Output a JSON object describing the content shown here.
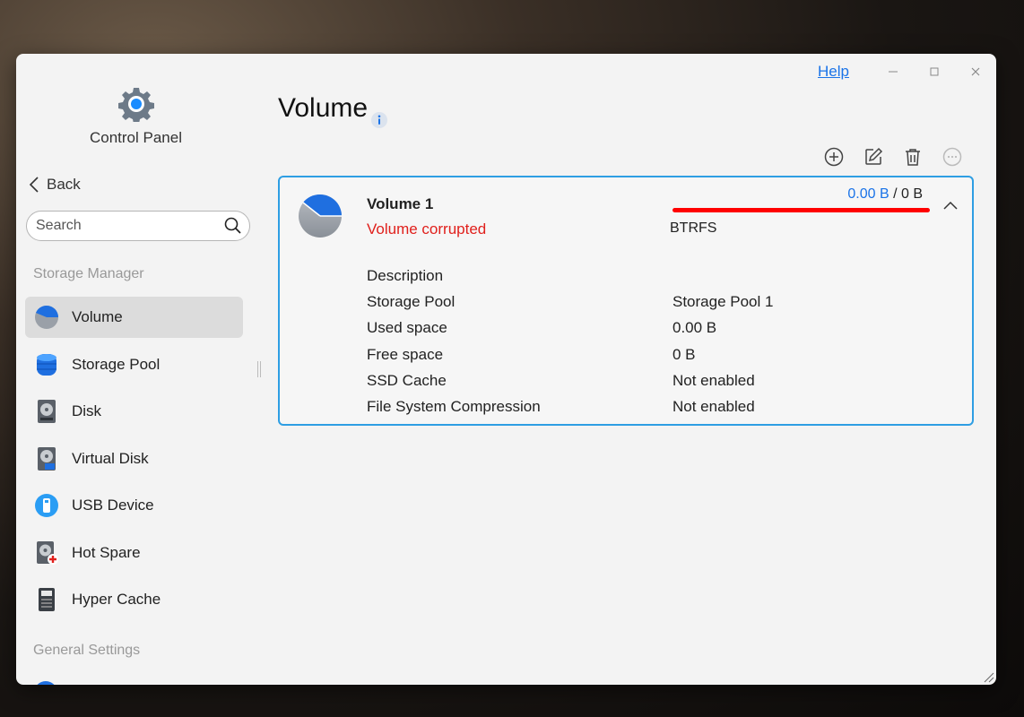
{
  "window": {
    "help_label": "Help"
  },
  "sidebar": {
    "app_name": "Control Panel",
    "back_label": "Back",
    "search_placeholder": "Search",
    "section_storage": "Storage Manager",
    "section_general": "General Settings",
    "items": [
      {
        "label": "Volume",
        "icon": "volume-pie-icon",
        "active": true
      },
      {
        "label": "Storage Pool",
        "icon": "storage-pool-icon"
      },
      {
        "label": "Disk",
        "icon": "disk-icon"
      },
      {
        "label": "Virtual Disk",
        "icon": "virtual-disk-icon"
      },
      {
        "label": "USB Device",
        "icon": "usb-icon"
      },
      {
        "label": "Hot Spare",
        "icon": "hot-spare-icon"
      },
      {
        "label": "Hyper Cache",
        "icon": "ssd-cache-icon"
      }
    ]
  },
  "main": {
    "title": "Volume",
    "volume": {
      "name": "Volume 1",
      "status": "Volume corrupted",
      "used": "0.00 B",
      "separator": "/",
      "total": "0 B",
      "usage_fraction": 1.0,
      "filesystem": "BTRFS",
      "details": [
        {
          "label": "Description",
          "value": ""
        },
        {
          "label": "Storage Pool",
          "value": "Storage Pool 1"
        },
        {
          "label": "Used space",
          "value": "0.00 B"
        },
        {
          "label": "Free space",
          "value": "0 B"
        },
        {
          "label": "SSD Cache",
          "value": "Not enabled"
        },
        {
          "label": "File System Compression",
          "value": "Not enabled"
        }
      ]
    }
  },
  "colors": {
    "accent": "#1a73e8",
    "error": "#e0201c",
    "card_border": "#2e9ee3"
  }
}
